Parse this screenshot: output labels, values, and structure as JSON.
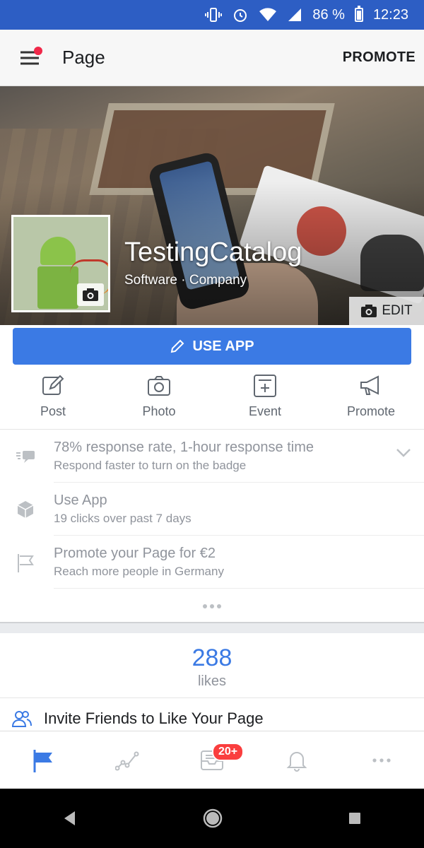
{
  "status_bar": {
    "battery": "86 %",
    "time": "12:23"
  },
  "app_bar": {
    "title": "Page",
    "promote_label": "PROMOTE"
  },
  "page": {
    "name": "TestingCatalog",
    "category": "Software · Company",
    "edit_label": "EDIT",
    "use_app_label": "USE APP"
  },
  "actions": [
    {
      "label": "Post",
      "icon": "compose-icon"
    },
    {
      "label": "Photo",
      "icon": "camera-icon"
    },
    {
      "label": "Event",
      "icon": "event-add-icon"
    },
    {
      "label": "Promote",
      "icon": "megaphone-icon"
    }
  ],
  "insights": [
    {
      "title": "78% response rate, 1-hour response time",
      "subtitle": "Respond faster to turn on the badge",
      "icon": "chat-icon"
    },
    {
      "title": "Use App",
      "subtitle": "19 clicks over past 7 days",
      "icon": "cube-icon"
    },
    {
      "title": "Promote your Page for €2",
      "subtitle": "Reach more people in Germany",
      "icon": "flag-icon"
    }
  ],
  "likes": {
    "count": "288",
    "label": "likes"
  },
  "invite_label": "Invite Friends to Like Your Page",
  "tabbar": {
    "inbox_badge": "20+"
  },
  "colors": {
    "brand_blue": "#3b7ae4",
    "status_bar": "#2d5ec4",
    "badge_red": "#fa3e3e"
  }
}
